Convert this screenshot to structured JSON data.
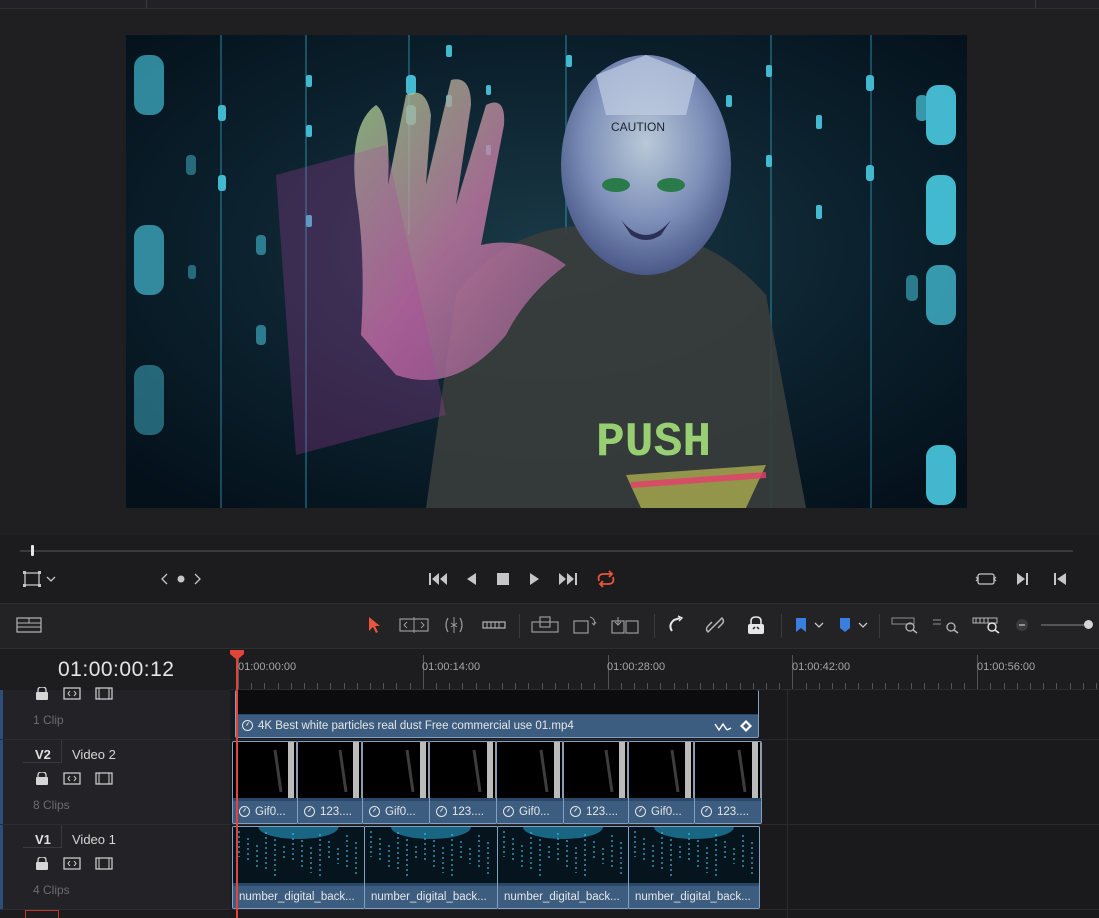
{
  "timecode": "01:00:00:12",
  "ruler_labels": [
    "01:00:00:00",
    "01:00:14:00",
    "01:00:28:00",
    "01:00:42:00",
    "01:00:56:00"
  ],
  "tracks": [
    {
      "id": "",
      "name": "",
      "count": "1 Clip"
    },
    {
      "id": "V2",
      "name": "Video 2",
      "count": "8 Clips"
    },
    {
      "id": "V1",
      "name": "Video 1",
      "count": "4 Clips"
    }
  ],
  "track3_clip": {
    "label": "4K Best white particles real dust Free commercial use 01.mp4"
  },
  "v2_clips": [
    "Gif0...",
    "123....",
    "Gif0...",
    "123....",
    "Gif0...",
    "123....",
    "Gif0...",
    "123...."
  ],
  "v1_clips": [
    "number_digital_back...",
    "number_digital_back...",
    "number_digital_back...",
    "number_digital_back..."
  ],
  "viewer": {
    "frame_text_caution": "CAUTION",
    "frame_text_push": "PUSH",
    "scrub_position": 0.01
  },
  "icons": {
    "transform": "crop-transform-icon",
    "loop": "loop-icon",
    "playhead_color": "#e0443a",
    "clip_color": "#3c5d80",
    "flag_color": "#3a7fe0"
  }
}
